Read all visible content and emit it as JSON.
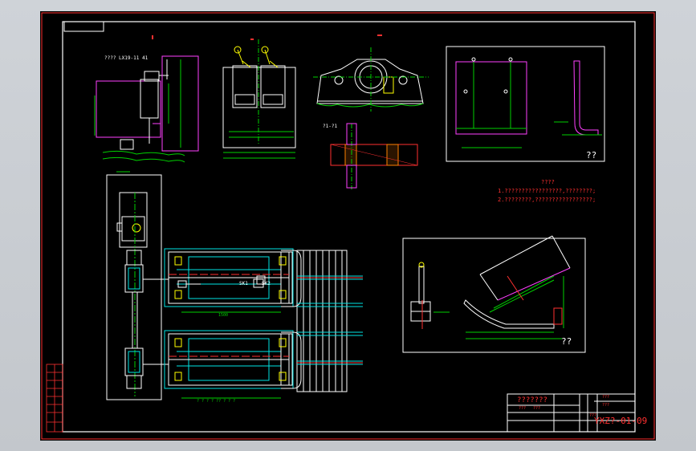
{
  "drawing": {
    "sheet_number": "YXZ?-01-09",
    "title_block_title": "???????",
    "title_block_small": [
      "???",
      "???"
    ],
    "small_labels": [
      "???",
      "???",
      "???"
    ],
    "notes": [
      "????",
      "1.?????????????????,????????;",
      "2.????????,?????????????????;"
    ],
    "view_labels": {
      "view_a": "??",
      "view_b": "??"
    },
    "motor_model": "???? LX19-11 41",
    "section_label": "?1-?1",
    "switch_labels": [
      "SK1",
      "SK2"
    ],
    "dimensions": {
      "overall_length": "1500",
      "bottom_dim": "? ? ? ? ?? ? ? ?"
    }
  },
  "colors": {
    "background": "#000000",
    "frame": "#ff3030",
    "white": "#ffffff",
    "cyan": "#00e5e5",
    "green": "#00d000",
    "yellow": "#ffff00",
    "magenta": "#ff40ff",
    "blue": "#4060ff",
    "orange": "#ff8000"
  }
}
